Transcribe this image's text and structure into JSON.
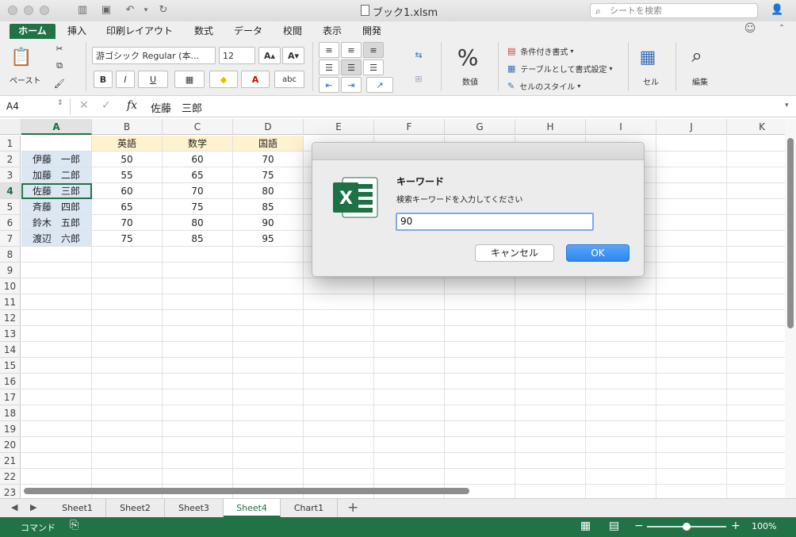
{
  "window": {
    "title": "ブック1.xlsm",
    "search_placeholder": "シートを検索"
  },
  "ribbon_tabs": [
    "ホーム",
    "挿入",
    "印刷レイアウト",
    "数式",
    "データ",
    "校閲",
    "表示",
    "開発"
  ],
  "active_tab": "ホーム",
  "ribbon": {
    "paste_label": "ペースト",
    "font_name": "游ゴシック Regular (本...",
    "font_size": "12",
    "bold": "B",
    "italic": "I",
    "underline": "U",
    "font_color_letter": "A",
    "abc_label": "abc",
    "percent": "%",
    "number_label": "数値",
    "conditional_format": "条件付き書式",
    "format_as_table": "テーブルとして書式設定",
    "cell_styles": "セルのスタイル",
    "cells_label": "セル",
    "editing_label": "編集"
  },
  "formula_bar": {
    "name_box": "A4",
    "fx": "fx",
    "content": "佐藤　三郎"
  },
  "grid": {
    "columns": [
      "A",
      "B",
      "C",
      "D",
      "E",
      "F",
      "G",
      "H",
      "I",
      "J",
      "K"
    ],
    "rows": [
      "1",
      "2",
      "3",
      "4",
      "5",
      "6",
      "7",
      "8",
      "9",
      "10",
      "11",
      "12",
      "13",
      "14",
      "15",
      "16",
      "17",
      "18",
      "19",
      "20",
      "21",
      "22",
      "23"
    ],
    "header_row": [
      "",
      "英語",
      "数学",
      "国語"
    ],
    "data": [
      [
        "伊藤　一郎",
        "50",
        "60",
        "70"
      ],
      [
        "加藤　二郎",
        "55",
        "65",
        "75"
      ],
      [
        "佐藤　三郎",
        "60",
        "70",
        "80"
      ],
      [
        "斉藤　四郎",
        "65",
        "75",
        "85"
      ],
      [
        "鈴木　五郎",
        "70",
        "80",
        "90"
      ],
      [
        "渡辺　六郎",
        "75",
        "85",
        "95"
      ]
    ],
    "active_cell": "A4"
  },
  "sheets": [
    "Sheet1",
    "Sheet2",
    "Sheet3",
    "Sheet4",
    "Chart1"
  ],
  "active_sheet": "Sheet4",
  "status": {
    "mode": "コマンド",
    "zoom": "100%"
  },
  "dialog": {
    "title": "キーワード",
    "message": "検索キーワードを入力してください",
    "input_value": "90",
    "cancel_label": "キャンセル",
    "ok_label": "OK"
  },
  "colors": {
    "accent": "#217346",
    "name_fill": "#dbe7f3",
    "header_fill": "#fff3cf",
    "ok_button": "#2f86ef"
  }
}
